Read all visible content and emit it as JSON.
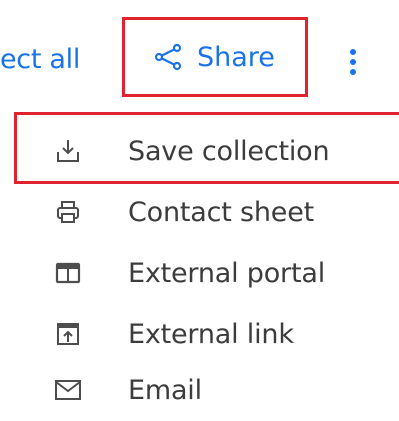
{
  "toolbar": {
    "select_all_label": "ect all",
    "share_label": "Share",
    "share_icon": "share-icon",
    "more_icon": "more-vert-icon"
  },
  "menu": {
    "items": [
      {
        "label": "Save collection",
        "icon": "download-icon"
      },
      {
        "label": "Contact sheet",
        "icon": "print-icon"
      },
      {
        "label": "External portal",
        "icon": "web-asset-icon"
      },
      {
        "label": "External link",
        "icon": "open-in-new-icon"
      },
      {
        "label": "Email",
        "icon": "mail-icon"
      }
    ]
  },
  "colors": {
    "accent": "#1a73e8",
    "highlight": "#e0232e",
    "text": "#3c3c3c",
    "icon": "#4d4d4d"
  }
}
